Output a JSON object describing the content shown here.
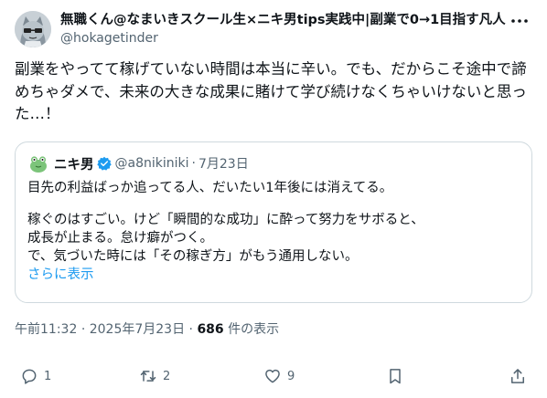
{
  "author": {
    "display_name": "無職くん@なまいきスクール生×ニキ男tips実践中|副業で0→1目指す凡人",
    "handle": "@hokagetinder"
  },
  "post": {
    "text": "副業をやってて稼げていない時間は本当に辛い。でも、だからこそ途中で諦めちゃダメで、未来の大きな成果に賭けて学び続けなくちゃいけないと思った…！"
  },
  "quoted": {
    "display_name": "ニキ男",
    "handle": "@a8nikiniki",
    "separator": "·",
    "date": "7月23日",
    "lines": [
      "目先の利益ばっか追ってる人、だいたい1年後には消えてる。",
      "稼ぐのはすごい。けど「瞬間的な成功」に酔って努力をサボると、",
      "成長が止まる。怠け癖がつく。",
      "で、気づいた時には「その稼ぎ方」がもう通用しない。"
    ],
    "show_more": "さらに表示"
  },
  "meta": {
    "time": "午前11:32",
    "sep1": "·",
    "date": "2025年7月23日",
    "sep2": "·",
    "views": "686",
    "views_label": " 件の表示"
  },
  "actions": {
    "replies": "1",
    "reposts": "2",
    "likes": "9"
  },
  "colors": {
    "text": "#0f1419",
    "secondary": "#536471",
    "link": "#1d9bf0",
    "border": "#cfd9de"
  }
}
